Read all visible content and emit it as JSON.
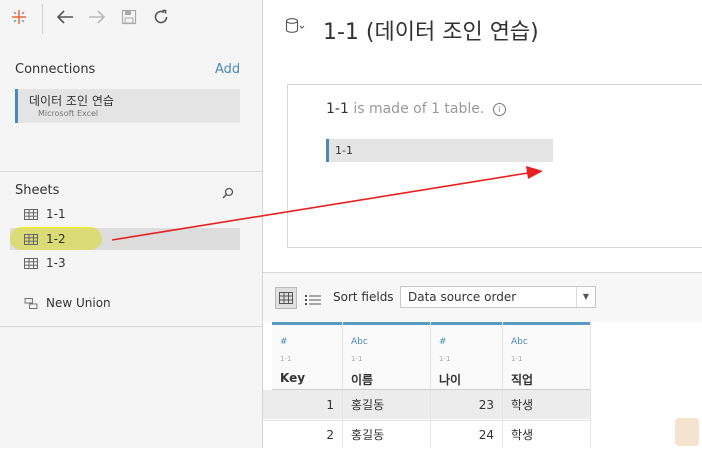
{
  "datasource": {
    "title": "1-1 (데이터 조인 연습)"
  },
  "connections": {
    "heading": "Connections",
    "add_label": "Add",
    "items": [
      {
        "name": "데이터 조인 연습",
        "type": "Microsoft Excel"
      }
    ]
  },
  "sheets": {
    "heading": "Sheets",
    "items": [
      {
        "label": "1-1"
      },
      {
        "label": "1-2"
      },
      {
        "label": "1-3"
      }
    ],
    "new_union": "New Union"
  },
  "canvas": {
    "made_of_name": "1-1",
    "made_of_text": " is made of 1 table.",
    "table_name": "1-1"
  },
  "grid_toolbar": {
    "sort_label": "Sort fields",
    "sort_value": "Data source order"
  },
  "grid": {
    "columns": [
      {
        "type": "#",
        "source": "1-1",
        "name": "Key"
      },
      {
        "type": "Abc",
        "source": "1-1",
        "name": "이름"
      },
      {
        "type": "#",
        "source": "1-1",
        "name": "나이"
      },
      {
        "type": "Abc",
        "source": "1-1",
        "name": "직업"
      }
    ],
    "rows": [
      {
        "key": "1",
        "name": "홍길동",
        "age": "23",
        "job": "학생"
      },
      {
        "key": "2",
        "name": "홍길동",
        "age": "24",
        "job": "학생"
      }
    ]
  },
  "colors": {
    "accent": "#4a8ab8",
    "highlight": "#f2f200",
    "arrow": "#e8211e"
  }
}
